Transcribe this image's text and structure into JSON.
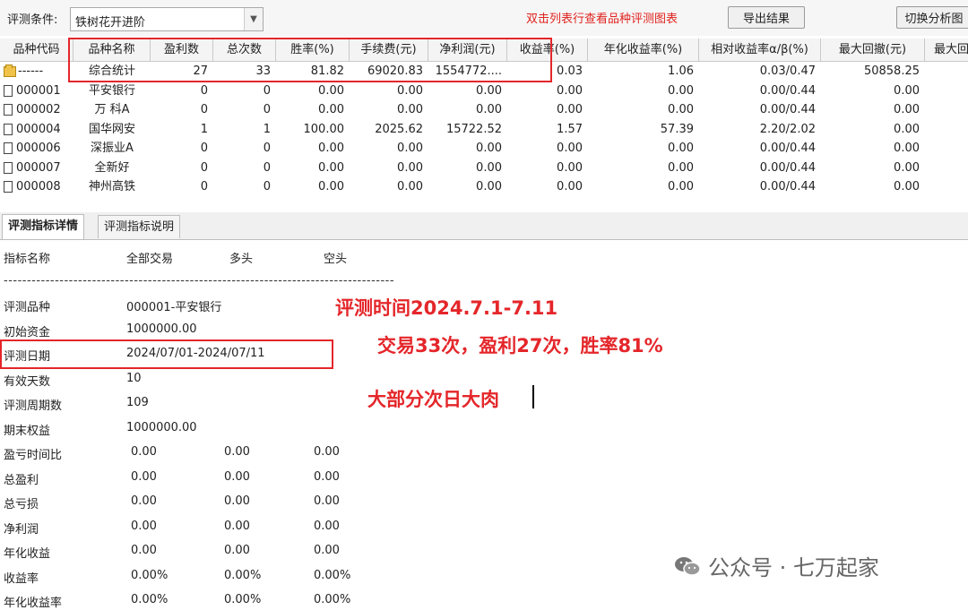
{
  "toolbar": {
    "condition_label": "评测条件:",
    "condition_value": "铁树花开进阶",
    "hint": "双击列表行查看品种评测图表",
    "export_button": "导出结果",
    "switch_button": "切换分析图"
  },
  "table": {
    "columns": [
      "品种代码",
      "品种名称",
      "盈利数",
      "总次数",
      "胜率(%)",
      "手续费(元)",
      "净利润(元)",
      "收益率(%)",
      "年化收益率(%)",
      "相对收益率α/β(%)",
      "最大回撤(元)",
      "最大回"
    ],
    "rows": [
      {
        "code": "------",
        "name": "综合统计",
        "win": "27",
        "total": "33",
        "rate": "81.82",
        "fee": "69020.83",
        "profit": "1554772....",
        "ret": "0.03",
        "annual": "1.06",
        "ab": "0.03/0.47",
        "dd": "50858.25",
        "icon": "folder-icon"
      },
      {
        "code": "000001",
        "name": "平安银行",
        "win": "0",
        "total": "0",
        "rate": "0.00",
        "fee": "0.00",
        "profit": "0.00",
        "ret": "0.00",
        "annual": "0.00",
        "ab": "0.00/0.44",
        "dd": "0.00",
        "icon": "document-icon"
      },
      {
        "code": "000002",
        "name": "万 科A",
        "win": "0",
        "total": "0",
        "rate": "0.00",
        "fee": "0.00",
        "profit": "0.00",
        "ret": "0.00",
        "annual": "0.00",
        "ab": "0.00/0.44",
        "dd": "0.00",
        "icon": "document-icon"
      },
      {
        "code": "000004",
        "name": "国华网安",
        "win": "1",
        "total": "1",
        "rate": "100.00",
        "fee": "2025.62",
        "profit": "15722.52",
        "ret": "1.57",
        "annual": "57.39",
        "ab": "2.20/2.02",
        "dd": "0.00",
        "icon": "document-icon"
      },
      {
        "code": "000006",
        "name": "深振业A",
        "win": "0",
        "total": "0",
        "rate": "0.00",
        "fee": "0.00",
        "profit": "0.00",
        "ret": "0.00",
        "annual": "0.00",
        "ab": "0.00/0.44",
        "dd": "0.00",
        "icon": "document-icon"
      },
      {
        "code": "000007",
        "name": "全新好",
        "win": "0",
        "total": "0",
        "rate": "0.00",
        "fee": "0.00",
        "profit": "0.00",
        "ret": "0.00",
        "annual": "0.00",
        "ab": "0.00/0.44",
        "dd": "0.00",
        "icon": "document-icon"
      },
      {
        "code": "000008",
        "name": "神州高铁",
        "win": "0",
        "total": "0",
        "rate": "0.00",
        "fee": "0.00",
        "profit": "0.00",
        "ret": "0.00",
        "annual": "0.00",
        "ab": "0.00/0.44",
        "dd": "0.00",
        "icon": "document-icon"
      }
    ]
  },
  "tabs": [
    "评测指标详情",
    "评测指标说明"
  ],
  "detail": {
    "header": [
      "指标名称",
      "全部交易",
      "多头",
      "空头"
    ],
    "divider": "------------------------------------------------------------------------------------------------------------",
    "rows": [
      {
        "label": "评测品种",
        "v1": "000001-平安银行",
        "v2": "",
        "v3": ""
      },
      {
        "label": "初始资金",
        "v1": "1000000.00",
        "v2": "",
        "v3": ""
      },
      {
        "label": "评测日期",
        "v1": "2024/07/01-2024/07/11",
        "v2": "",
        "v3": ""
      },
      {
        "label": "有效天数",
        "v1": "10",
        "v2": "",
        "v3": ""
      },
      {
        "label": "评测周期数",
        "v1": "109",
        "v2": "",
        "v3": ""
      },
      {
        "label": "期末权益",
        "v1": "1000000.00",
        "v2": "",
        "v3": ""
      },
      {
        "label": "盈亏时间比",
        "v1": "0.00",
        "v2": "0.00",
        "v3": "0.00"
      },
      {
        "label": "总盈利",
        "v1": "0.00",
        "v2": "0.00",
        "v3": "0.00"
      },
      {
        "label": "总亏损",
        "v1": "0.00",
        "v2": "0.00",
        "v3": "0.00"
      },
      {
        "label": "净利润",
        "v1": "0.00",
        "v2": "0.00",
        "v3": "0.00"
      },
      {
        "label": "年化收益",
        "v1": "0.00",
        "v2": "0.00",
        "v3": "0.00"
      },
      {
        "label": "收益率",
        "v1": "0.00%",
        "v2": "0.00%",
        "v3": "0.00%"
      },
      {
        "label": "年化收益率",
        "v1": "0.00%",
        "v2": "0.00%",
        "v3": "0.00%"
      }
    ]
  },
  "annotations": {
    "line1": "评测时间2024.7.1-7.11",
    "line2": "交易33次，盈利27次，胜率81%",
    "line3": "大部分次日大肉",
    "accent_color": "#e4262a"
  },
  "watermark": {
    "text": "公众号 · 七万起家",
    "icon": "wechat-icon"
  }
}
